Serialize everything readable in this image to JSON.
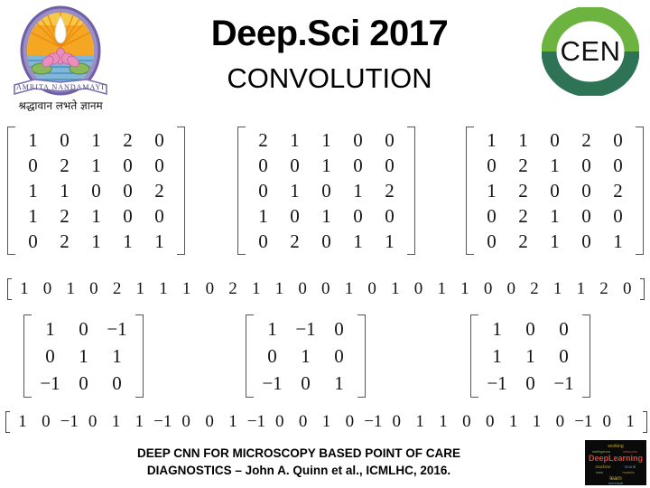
{
  "header": {
    "title": "Deep.Sci 2017",
    "subtitle": "CONVOLUTION",
    "left_logo_name": "amrita-vishwa-vidyapeetham-logo",
    "left_logo_motto": "श्रद्धावान लभते ज्ञानम",
    "left_logo_banner": "AMRITA NANDAMAYI",
    "right_logo_text": "CEN",
    "right_logo_colors": {
      "top_green": "#6cb33f",
      "bottom_green": "#2f7357"
    }
  },
  "matrices": {
    "input_channels": [
      {
        "name": "input-channel-1",
        "rows": [
          [
            1,
            0,
            1,
            2,
            0
          ],
          [
            0,
            2,
            1,
            0,
            0
          ],
          [
            1,
            1,
            0,
            0,
            2
          ],
          [
            1,
            2,
            1,
            0,
            0
          ],
          [
            0,
            2,
            1,
            1,
            1
          ]
        ]
      },
      {
        "name": "input-channel-2",
        "rows": [
          [
            2,
            1,
            1,
            0,
            0
          ],
          [
            0,
            0,
            1,
            0,
            0
          ],
          [
            0,
            1,
            0,
            1,
            2
          ],
          [
            1,
            0,
            1,
            0,
            0
          ],
          [
            0,
            2,
            0,
            1,
            1
          ]
        ]
      },
      {
        "name": "input-channel-3",
        "rows": [
          [
            1,
            1,
            0,
            2,
            0
          ],
          [
            0,
            2,
            1,
            0,
            0
          ],
          [
            1,
            2,
            0,
            0,
            2
          ],
          [
            0,
            2,
            1,
            0,
            0
          ],
          [
            0,
            2,
            1,
            0,
            1
          ]
        ]
      }
    ],
    "input_flat_vector": [
      1,
      0,
      1,
      0,
      2,
      1,
      1,
      1,
      0,
      2,
      1,
      1,
      0,
      0,
      1,
      0,
      1,
      0,
      1,
      1,
      0,
      0,
      2,
      1,
      1,
      2,
      0
    ],
    "kernels": [
      {
        "name": "kernel-1",
        "rows": [
          [
            1,
            0,
            "−1"
          ],
          [
            0,
            1,
            1
          ],
          [
            "−1",
            0,
            0
          ]
        ]
      },
      {
        "name": "kernel-2",
        "rows": [
          [
            1,
            "−1",
            0
          ],
          [
            0,
            1,
            0
          ],
          [
            "−1",
            0,
            1
          ]
        ]
      },
      {
        "name": "kernel-3",
        "rows": [
          [
            1,
            0,
            0
          ],
          [
            1,
            1,
            0
          ],
          [
            "−1",
            0,
            "−1"
          ]
        ]
      }
    ],
    "kernel_flat_vector": [
      1,
      0,
      "−1",
      0,
      1,
      1,
      "−1",
      0,
      0,
      1,
      "−1",
      0,
      0,
      1,
      0,
      "−1",
      0,
      1,
      1,
      0,
      0,
      1,
      1,
      0,
      "−1",
      0,
      1
    ]
  },
  "footer": {
    "line1": "DEEP CNN FOR MICROSCOPY BASED POINT OF CARE",
    "line2": "DIAGNOSTICS – John A. Quinn et al., ICMLHC, 2016.",
    "badge_name": "deep-learning-wordcloud-image",
    "badge_word": "Deep Learning"
  }
}
